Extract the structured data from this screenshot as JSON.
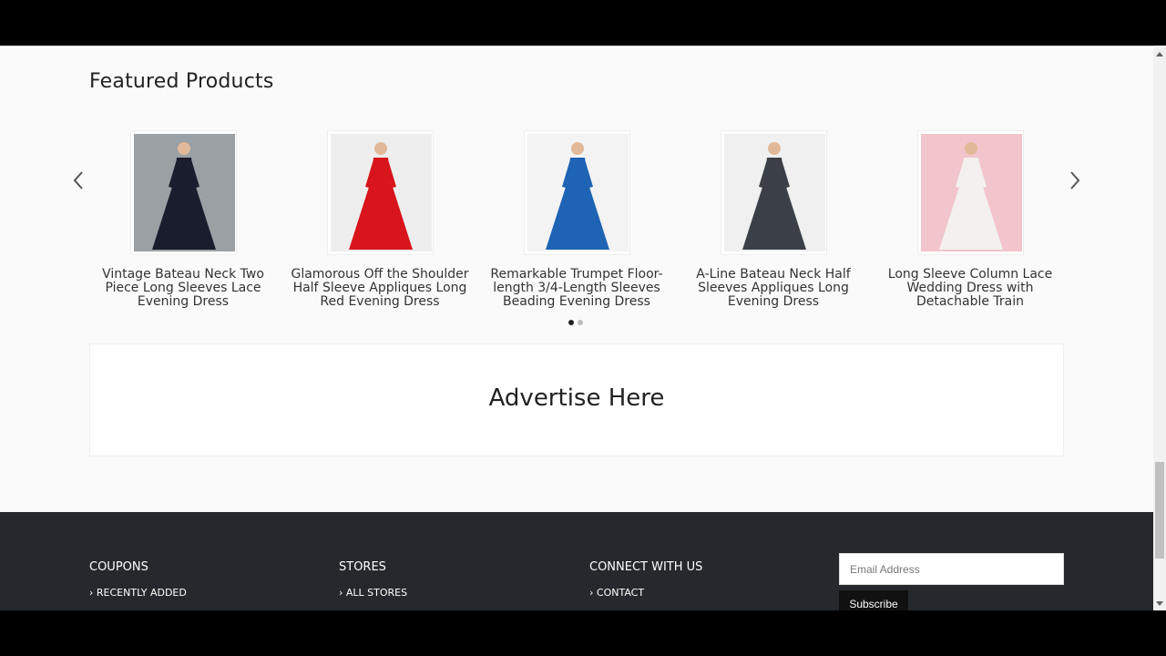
{
  "featured": {
    "title": "Featured Products",
    "products": [
      {
        "name": "Vintage Bateau Neck Two Piece Long Sleeves Lace Evening Dress",
        "dress_color": "#1a1d2e",
        "bg_color": "#9aa0a4"
      },
      {
        "name": "Glamorous Off the Shoulder Half Sleeve Appliques Long Red Evening Dress",
        "dress_color": "#d8141c",
        "bg_color": "#eeeeee"
      },
      {
        "name": "Remarkable Trumpet Floor-length 3/4-Length Sleeves Beading Evening Dress",
        "dress_color": "#1e63b4",
        "bg_color": "#f3f3f3"
      },
      {
        "name": "A-Line Bateau Neck Half Sleeves Appliques Long Evening Dress",
        "dress_color": "#3b4048",
        "bg_color": "#f0f0f0"
      },
      {
        "name": "Long Sleeve Column Lace Wedding Dress with Detachable Train",
        "dress_color": "#f4f0f0",
        "bg_color": "#f2c4cc"
      }
    ],
    "prev_icon": "chevron-left-icon",
    "next_icon": "chevron-right-icon",
    "pagination": {
      "pages": 2,
      "active": 1
    }
  },
  "ad": {
    "text": "Advertise Here"
  },
  "footer": {
    "coupons": {
      "title": "COUPONS",
      "link": "› RECENTLY ADDED"
    },
    "stores": {
      "title": "STORES",
      "link": "› ALL STORES"
    },
    "connect": {
      "title": "CONNECT WITH US",
      "link": "› CONTACT"
    },
    "newsletter": {
      "placeholder": "Email Address",
      "button": "Subscribe"
    }
  },
  "colors": {
    "footer_bg": "#25282c",
    "page_bg": "#fafafa"
  }
}
